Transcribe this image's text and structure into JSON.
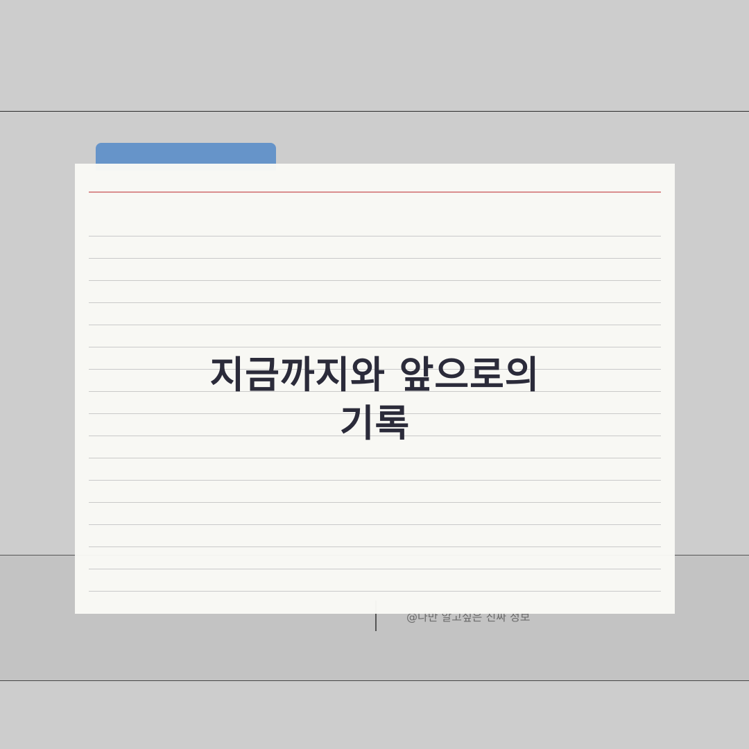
{
  "card": {
    "title_line1": "지금까지와 앞으로의",
    "title_line2": "기록"
  },
  "credit": {
    "text": "@나만 알고싶은 진짜 정보"
  },
  "colors": {
    "background": "#cdcdcd",
    "tab": "#6694c9",
    "card": "#f9f9f5",
    "margin_line": "#d98e8e",
    "title_text": "#2b2b3a"
  }
}
